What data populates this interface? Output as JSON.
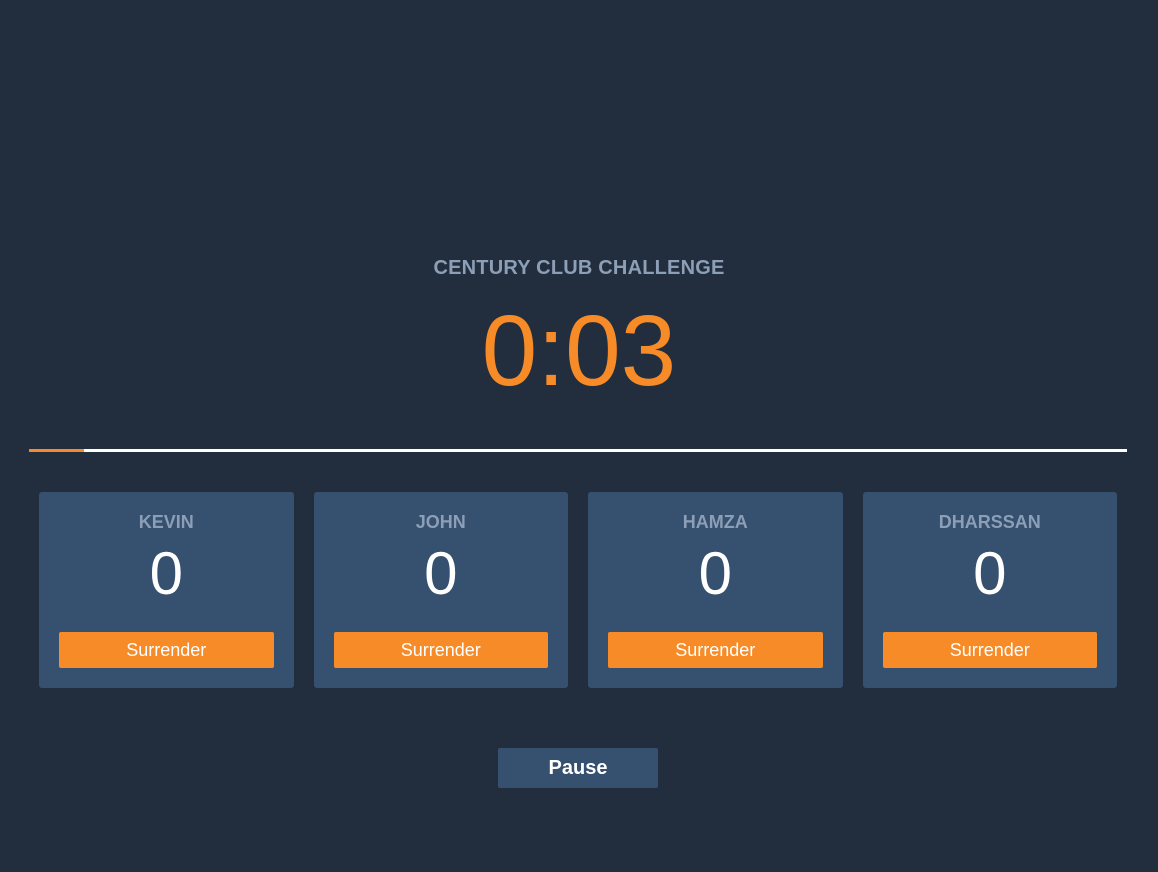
{
  "challenge": {
    "title": "CENTURY CLUB CHALLENGE",
    "timer": "0:03",
    "progress_fraction": 0.05
  },
  "players": [
    {
      "name": "KEVIN",
      "score": "0",
      "surrender_label": "Surrender"
    },
    {
      "name": "JOHN",
      "score": "0",
      "surrender_label": "Surrender"
    },
    {
      "name": "HAMZA",
      "score": "0",
      "surrender_label": "Surrender"
    },
    {
      "name": "DHARSSAN",
      "score": "0",
      "surrender_label": "Surrender"
    }
  ],
  "controls": {
    "pause_label": "Pause"
  },
  "colors": {
    "background": "#222e3e",
    "accent": "#f68b27",
    "card": "#36506f",
    "muted_text": "#8d9fb6"
  }
}
